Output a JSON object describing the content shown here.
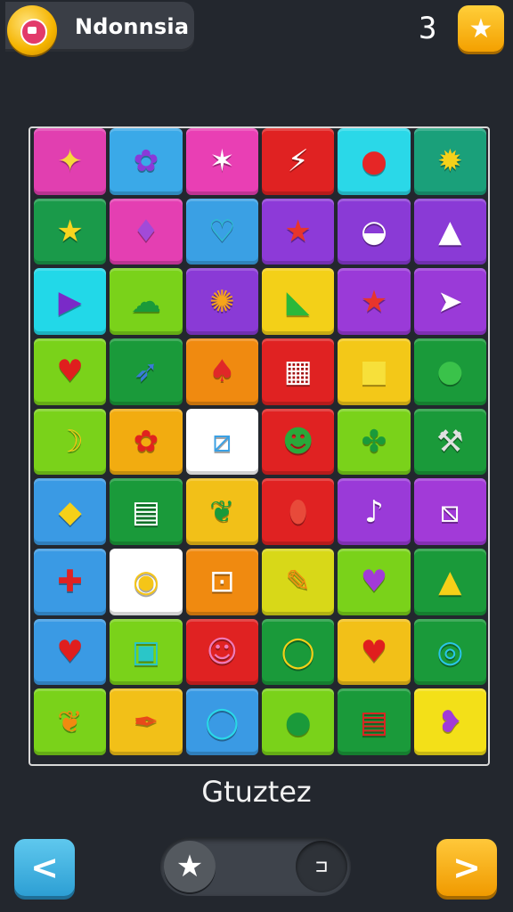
{
  "header": {
    "player_name": "Ndonnsia",
    "score": "3",
    "avatar_icon": "badge-icon",
    "star_icon": "★"
  },
  "board": {
    "tiles": [
      {
        "bg": "#e13fb0",
        "glyph": "✦",
        "color": "#f7d93a"
      },
      {
        "bg": "#3aa9e8",
        "glyph": "✿",
        "color": "#8a3ad8"
      },
      {
        "bg": "#e93fb4",
        "glyph": "✶",
        "color": "#ffffff"
      },
      {
        "bg": "#e02222",
        "glyph": "⚡",
        "color": "#ffffff"
      },
      {
        "bg": "#2ad8e8",
        "glyph": "●",
        "color": "#e62626"
      },
      {
        "bg": "#1aa07a",
        "glyph": "✹",
        "color": "#f5d11a"
      },
      {
        "bg": "#1a9a4a",
        "glyph": "★",
        "color": "#f7d51f"
      },
      {
        "bg": "#e43fb2",
        "glyph": "♦",
        "color": "#a24ad8"
      },
      {
        "bg": "#3aa0e4",
        "glyph": "♡",
        "color": "#2ac6c8"
      },
      {
        "bg": "#8d3ad8",
        "glyph": "★",
        "color": "#e8352c"
      },
      {
        "bg": "#8a3ad6",
        "glyph": "◒",
        "color": "#ffffff"
      },
      {
        "bg": "#8a3ad6",
        "glyph": "▲",
        "color": "#ffffff"
      },
      {
        "bg": "#22d8e8",
        "glyph": "▶",
        "color": "#7a2ac8"
      },
      {
        "bg": "#7ad21a",
        "glyph": "☁",
        "color": "#1a9a3a"
      },
      {
        "bg": "#8a3ad6",
        "glyph": "✺",
        "color": "#f6a41a"
      },
      {
        "bg": "#f3d018",
        "glyph": "◣",
        "color": "#2ab83a"
      },
      {
        "bg": "#9a3ad8",
        "glyph": "★",
        "color": "#e8352c"
      },
      {
        "bg": "#9a3ad8",
        "glyph": "➤",
        "color": "#ffffff"
      },
      {
        "bg": "#7ad21a",
        "glyph": "♥",
        "color": "#e01e1e"
      },
      {
        "bg": "#1a9a3a",
        "glyph": "➶",
        "color": "#3a7ad8"
      },
      {
        "bg": "#f08a10",
        "glyph": "♠",
        "color": "#e02828"
      },
      {
        "bg": "#e02222",
        "glyph": "▦",
        "color": "#ffffff"
      },
      {
        "bg": "#f3c818",
        "glyph": "■",
        "color": "#f7e03a"
      },
      {
        "bg": "#1a9a3a",
        "glyph": "●",
        "color": "#3ac24a"
      },
      {
        "bg": "#7ad21a",
        "glyph": "☽",
        "color": "#f5c518"
      },
      {
        "bg": "#f2ac10",
        "glyph": "✿",
        "color": "#e0231e"
      },
      {
        "bg": "#ffffff",
        "glyph": "⧄",
        "color": "#3aa0e4"
      },
      {
        "bg": "#e02222",
        "glyph": "☻",
        "color": "#2aa83a"
      },
      {
        "bg": "#7ad21a",
        "glyph": "✤",
        "color": "#1a9a3a"
      },
      {
        "bg": "#1a9a3a",
        "glyph": "⚒",
        "color": "#e0e0e0"
      },
      {
        "bg": "#3a9ae4",
        "glyph": "◆",
        "color": "#f5d018"
      },
      {
        "bg": "#1a9a3a",
        "glyph": "▤",
        "color": "#ffffff"
      },
      {
        "bg": "#f2c018",
        "glyph": "❦",
        "color": "#1a9a3a"
      },
      {
        "bg": "#e02222",
        "glyph": "⬮",
        "color": "#e84a3a"
      },
      {
        "bg": "#9a3ad8",
        "glyph": "♪",
        "color": "#ffffff"
      },
      {
        "bg": "#a23ad8",
        "glyph": "⧅",
        "color": "#ffffff"
      },
      {
        "bg": "#3a9ae4",
        "glyph": "✚",
        "color": "#e02222"
      },
      {
        "bg": "#ffffff",
        "glyph": "◉",
        "color": "#f5c518"
      },
      {
        "bg": "#f08a10",
        "glyph": "⊡",
        "color": "#ffffff"
      },
      {
        "bg": "#d8d818",
        "glyph": "✎",
        "color": "#f08a10"
      },
      {
        "bg": "#7ad21a",
        "glyph": "♥",
        "color": "#a23ad8"
      },
      {
        "bg": "#1a9a3a",
        "glyph": "▲",
        "color": "#f5d018"
      },
      {
        "bg": "#3a9ae4",
        "glyph": "♥",
        "color": "#e01e1e"
      },
      {
        "bg": "#7ad21a",
        "glyph": "▣",
        "color": "#2ac6c8"
      },
      {
        "bg": "#e02222",
        "glyph": "☺",
        "color": "#f07ab8"
      },
      {
        "bg": "#1a9a3a",
        "glyph": "◯",
        "color": "#f5d018"
      },
      {
        "bg": "#f2c018",
        "glyph": "♥",
        "color": "#e01e1e"
      },
      {
        "bg": "#1a9a3a",
        "glyph": "◎",
        "color": "#2ac6e8"
      },
      {
        "bg": "#7ad21a",
        "glyph": "❦",
        "color": "#f08a10"
      },
      {
        "bg": "#f2c018",
        "glyph": "✒",
        "color": "#e84a1a"
      },
      {
        "bg": "#3a9ae4",
        "glyph": "◯",
        "color": "#2ad8e8"
      },
      {
        "bg": "#7ad21a",
        "glyph": "●",
        "color": "#1a9a3a"
      },
      {
        "bg": "#1a9a3a",
        "glyph": "▤",
        "color": "#e02222"
      },
      {
        "bg": "#f3e018",
        "glyph": "❥",
        "color": "#a23ad8"
      }
    ]
  },
  "caption": "Gtuztez",
  "controls": {
    "back_label": "<",
    "next_label": ">",
    "toggle_left_icon": "★",
    "toggle_right_icon": "⊐"
  }
}
